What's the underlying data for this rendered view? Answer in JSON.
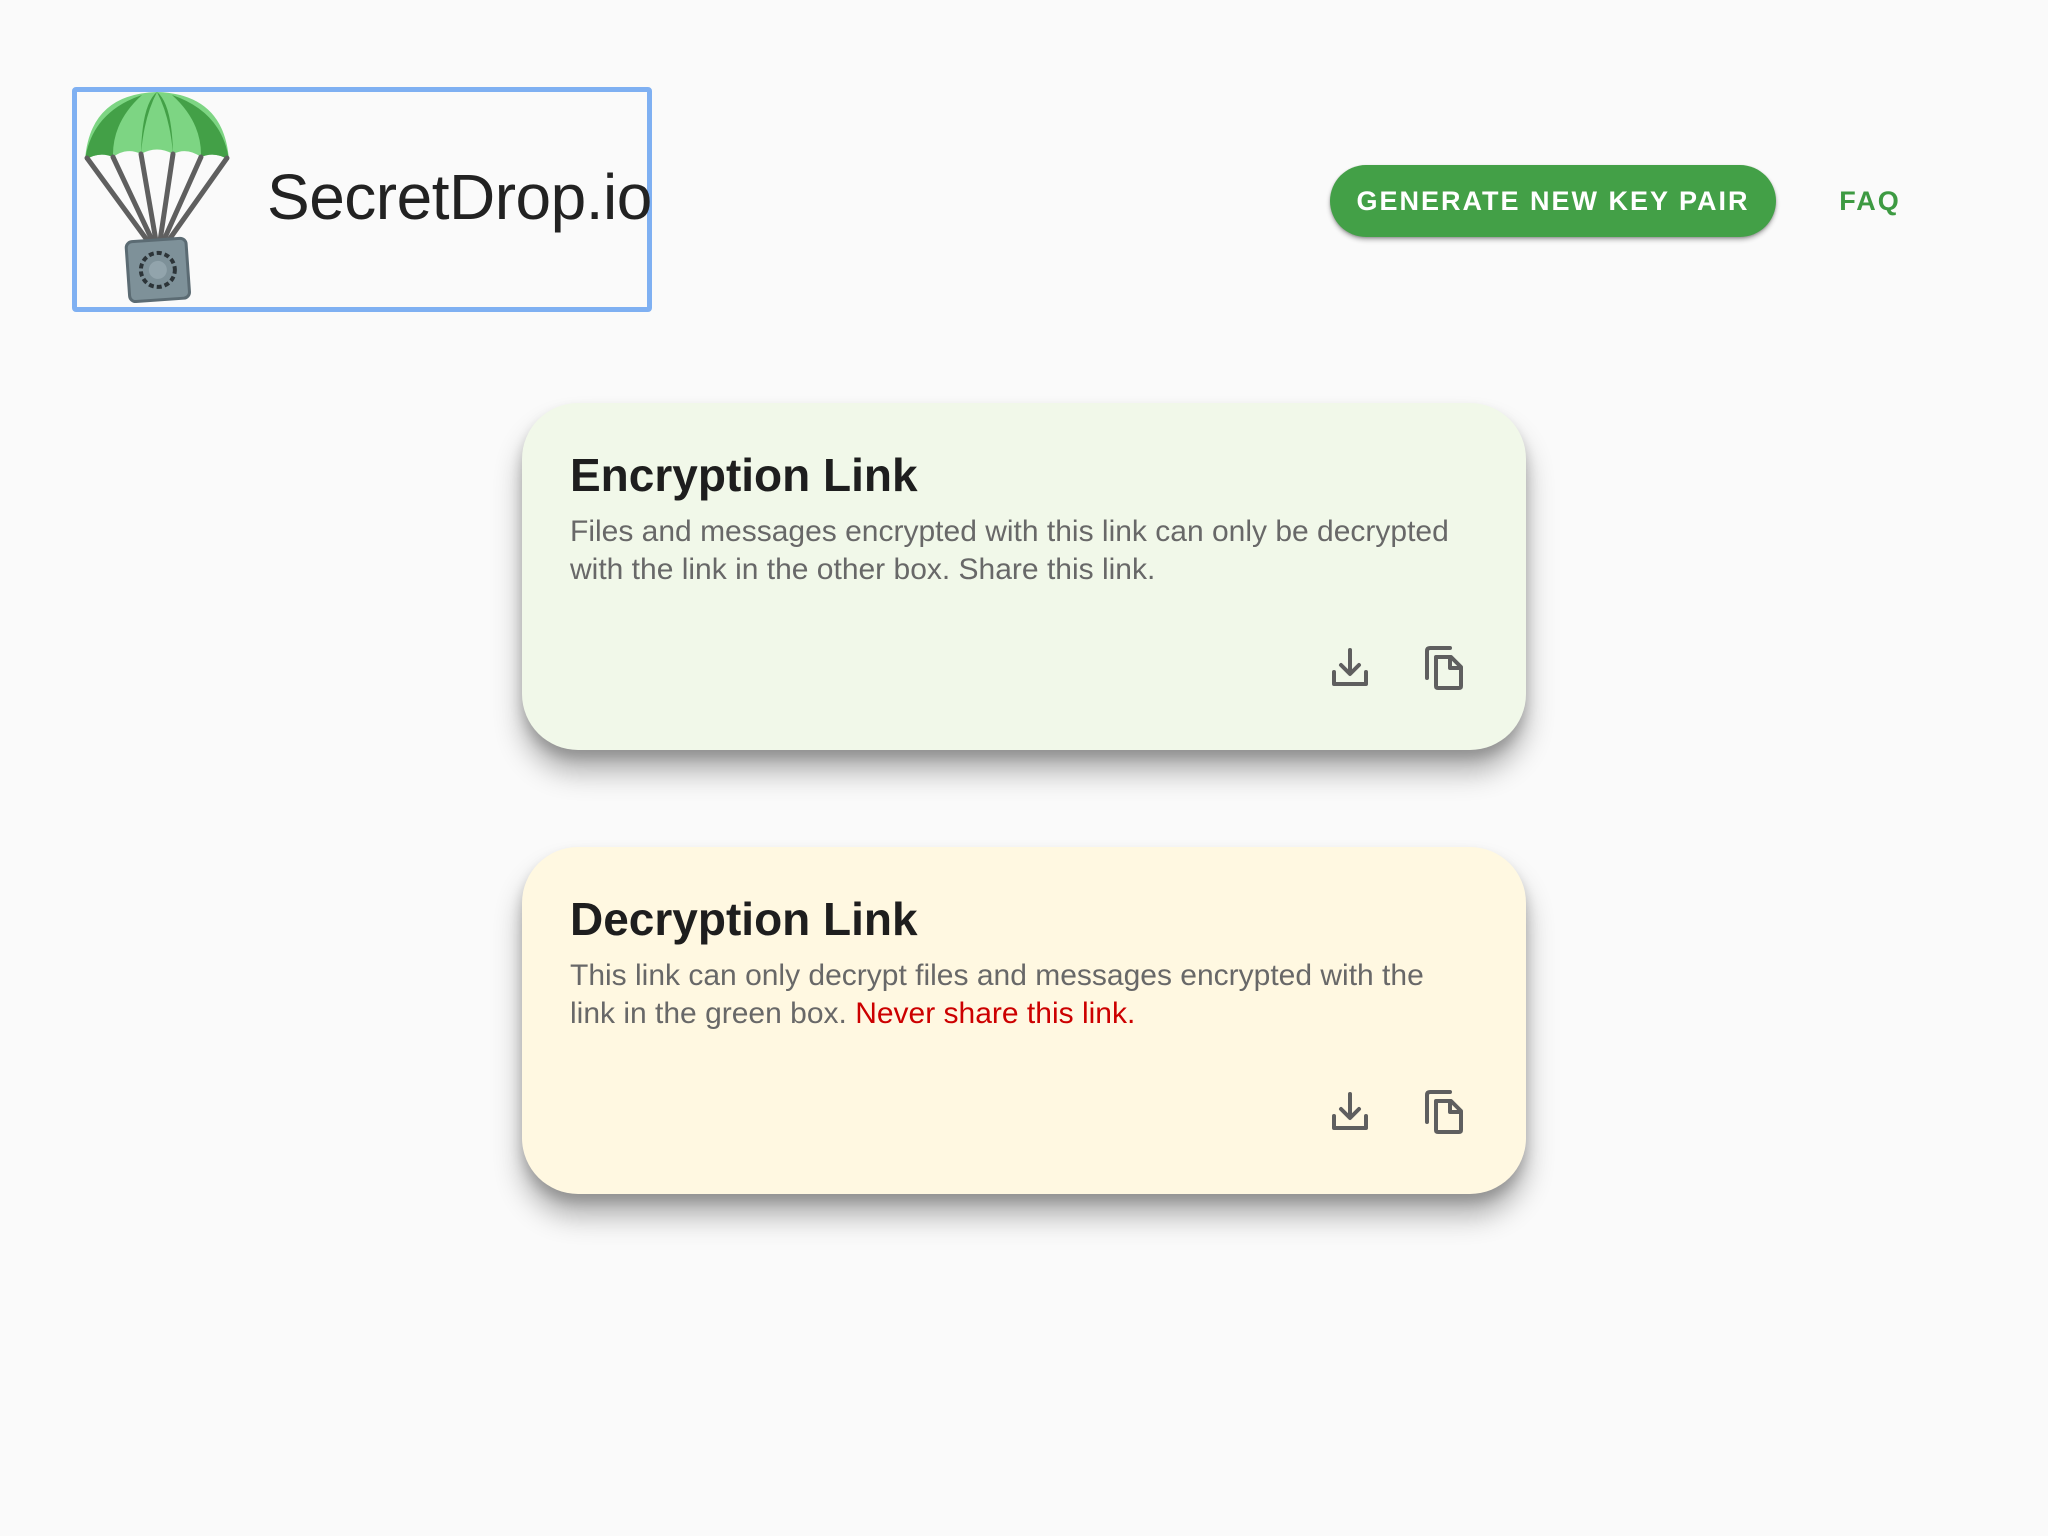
{
  "header": {
    "logo_text": "SecretDrop.io",
    "logo_icon": "parachute-safe-icon",
    "generate_button_label": "GENERATE NEW KEY PAIR",
    "faq_label": "FAQ"
  },
  "colors": {
    "accent_green": "#43a047",
    "faq_green": "#3d9a42",
    "encrypt_card_bg": "#f1f8e9",
    "decrypt_card_bg": "#fff8e1",
    "warning_red": "#cc0000",
    "focus_outline": "#7fb0f2"
  },
  "encryption_card": {
    "title": "Encryption Link",
    "description": "Files and messages encrypted with this link can only be decrypted with the link in the other box. Share this link.",
    "download_icon": "download-icon",
    "copy_icon": "copy-icon"
  },
  "decryption_card": {
    "title": "Decryption Link",
    "description": "This link can only decrypt files and messages encrypted with the link in the green box.",
    "warning": "Never share this link.",
    "download_icon": "download-icon",
    "copy_icon": "copy-icon"
  }
}
